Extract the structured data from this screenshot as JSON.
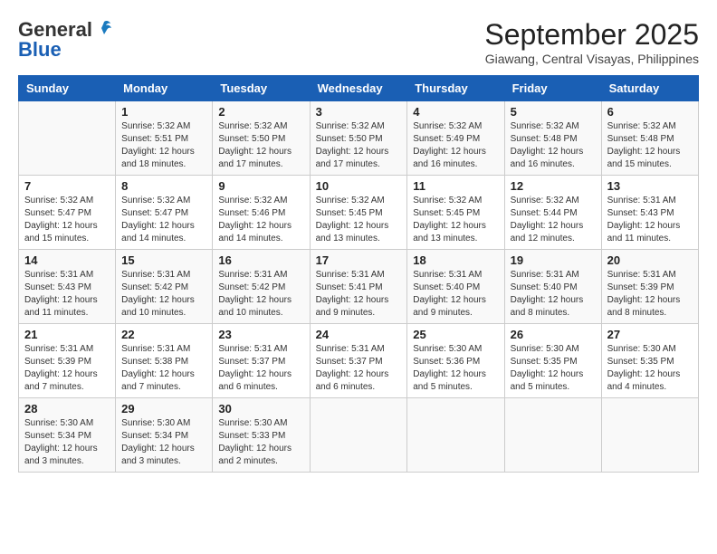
{
  "header": {
    "logo_general": "General",
    "logo_blue": "Blue",
    "month_year": "September 2025",
    "location": "Giawang, Central Visayas, Philippines"
  },
  "days_of_week": [
    "Sunday",
    "Monday",
    "Tuesday",
    "Wednesday",
    "Thursday",
    "Friday",
    "Saturday"
  ],
  "weeks": [
    [
      {
        "day": "",
        "info": ""
      },
      {
        "day": "1",
        "info": "Sunrise: 5:32 AM\nSunset: 5:51 PM\nDaylight: 12 hours\nand 18 minutes."
      },
      {
        "day": "2",
        "info": "Sunrise: 5:32 AM\nSunset: 5:50 PM\nDaylight: 12 hours\nand 17 minutes."
      },
      {
        "day": "3",
        "info": "Sunrise: 5:32 AM\nSunset: 5:50 PM\nDaylight: 12 hours\nand 17 minutes."
      },
      {
        "day": "4",
        "info": "Sunrise: 5:32 AM\nSunset: 5:49 PM\nDaylight: 12 hours\nand 16 minutes."
      },
      {
        "day": "5",
        "info": "Sunrise: 5:32 AM\nSunset: 5:48 PM\nDaylight: 12 hours\nand 16 minutes."
      },
      {
        "day": "6",
        "info": "Sunrise: 5:32 AM\nSunset: 5:48 PM\nDaylight: 12 hours\nand 15 minutes."
      }
    ],
    [
      {
        "day": "7",
        "info": "Sunrise: 5:32 AM\nSunset: 5:47 PM\nDaylight: 12 hours\nand 15 minutes."
      },
      {
        "day": "8",
        "info": "Sunrise: 5:32 AM\nSunset: 5:47 PM\nDaylight: 12 hours\nand 14 minutes."
      },
      {
        "day": "9",
        "info": "Sunrise: 5:32 AM\nSunset: 5:46 PM\nDaylight: 12 hours\nand 14 minutes."
      },
      {
        "day": "10",
        "info": "Sunrise: 5:32 AM\nSunset: 5:45 PM\nDaylight: 12 hours\nand 13 minutes."
      },
      {
        "day": "11",
        "info": "Sunrise: 5:32 AM\nSunset: 5:45 PM\nDaylight: 12 hours\nand 13 minutes."
      },
      {
        "day": "12",
        "info": "Sunrise: 5:32 AM\nSunset: 5:44 PM\nDaylight: 12 hours\nand 12 minutes."
      },
      {
        "day": "13",
        "info": "Sunrise: 5:31 AM\nSunset: 5:43 PM\nDaylight: 12 hours\nand 11 minutes."
      }
    ],
    [
      {
        "day": "14",
        "info": "Sunrise: 5:31 AM\nSunset: 5:43 PM\nDaylight: 12 hours\nand 11 minutes."
      },
      {
        "day": "15",
        "info": "Sunrise: 5:31 AM\nSunset: 5:42 PM\nDaylight: 12 hours\nand 10 minutes."
      },
      {
        "day": "16",
        "info": "Sunrise: 5:31 AM\nSunset: 5:42 PM\nDaylight: 12 hours\nand 10 minutes."
      },
      {
        "day": "17",
        "info": "Sunrise: 5:31 AM\nSunset: 5:41 PM\nDaylight: 12 hours\nand 9 minutes."
      },
      {
        "day": "18",
        "info": "Sunrise: 5:31 AM\nSunset: 5:40 PM\nDaylight: 12 hours\nand 9 minutes."
      },
      {
        "day": "19",
        "info": "Sunrise: 5:31 AM\nSunset: 5:40 PM\nDaylight: 12 hours\nand 8 minutes."
      },
      {
        "day": "20",
        "info": "Sunrise: 5:31 AM\nSunset: 5:39 PM\nDaylight: 12 hours\nand 8 minutes."
      }
    ],
    [
      {
        "day": "21",
        "info": "Sunrise: 5:31 AM\nSunset: 5:39 PM\nDaylight: 12 hours\nand 7 minutes."
      },
      {
        "day": "22",
        "info": "Sunrise: 5:31 AM\nSunset: 5:38 PM\nDaylight: 12 hours\nand 7 minutes."
      },
      {
        "day": "23",
        "info": "Sunrise: 5:31 AM\nSunset: 5:37 PM\nDaylight: 12 hours\nand 6 minutes."
      },
      {
        "day": "24",
        "info": "Sunrise: 5:31 AM\nSunset: 5:37 PM\nDaylight: 12 hours\nand 6 minutes."
      },
      {
        "day": "25",
        "info": "Sunrise: 5:30 AM\nSunset: 5:36 PM\nDaylight: 12 hours\nand 5 minutes."
      },
      {
        "day": "26",
        "info": "Sunrise: 5:30 AM\nSunset: 5:35 PM\nDaylight: 12 hours\nand 5 minutes."
      },
      {
        "day": "27",
        "info": "Sunrise: 5:30 AM\nSunset: 5:35 PM\nDaylight: 12 hours\nand 4 minutes."
      }
    ],
    [
      {
        "day": "28",
        "info": "Sunrise: 5:30 AM\nSunset: 5:34 PM\nDaylight: 12 hours\nand 3 minutes."
      },
      {
        "day": "29",
        "info": "Sunrise: 5:30 AM\nSunset: 5:34 PM\nDaylight: 12 hours\nand 3 minutes."
      },
      {
        "day": "30",
        "info": "Sunrise: 5:30 AM\nSunset: 5:33 PM\nDaylight: 12 hours\nand 2 minutes."
      },
      {
        "day": "",
        "info": ""
      },
      {
        "day": "",
        "info": ""
      },
      {
        "day": "",
        "info": ""
      },
      {
        "day": "",
        "info": ""
      }
    ]
  ]
}
